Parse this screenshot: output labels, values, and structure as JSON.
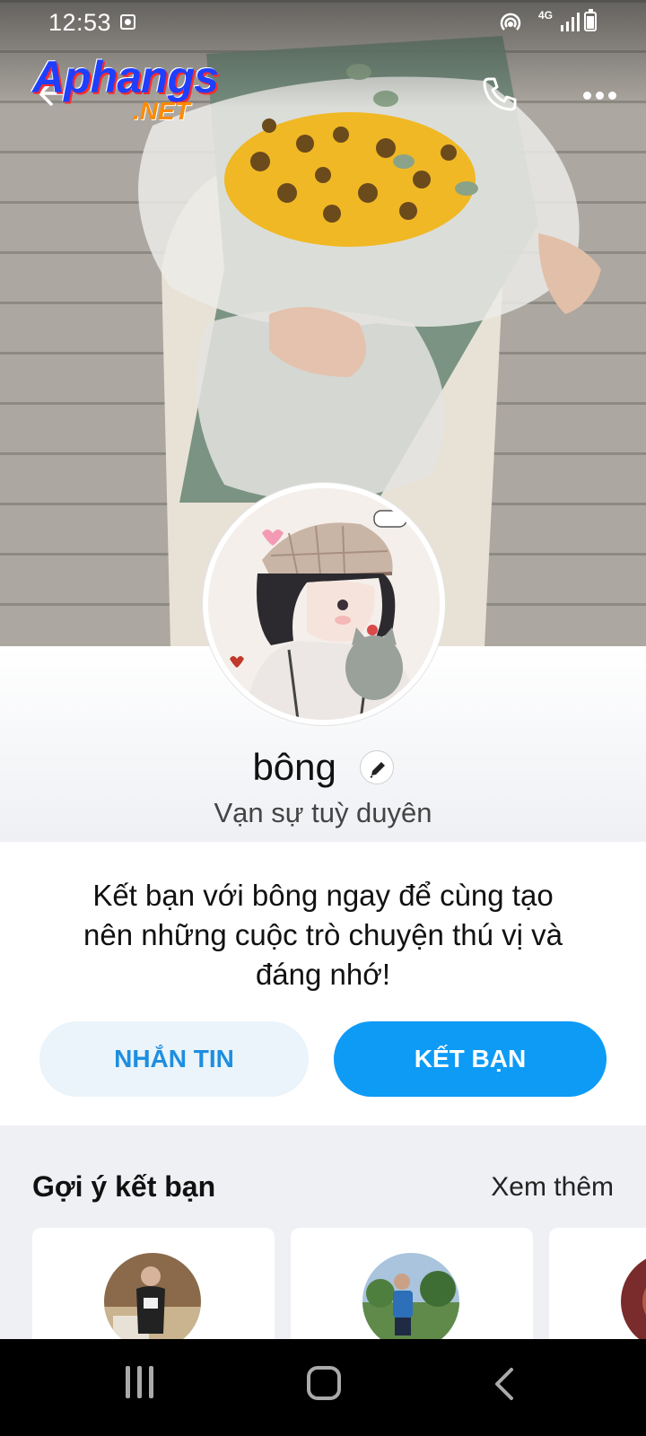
{
  "status_bar": {
    "time": "12:53",
    "network": "4G"
  },
  "watermark": {
    "main": "Aphangs",
    "sub": ".NET"
  },
  "top_nav": {
    "back_icon": "arrow-left-icon",
    "call_icon": "phone-icon",
    "more_icon": "more-horizontal-icon"
  },
  "profile": {
    "name": "bông",
    "bio": "Vạn sự tuỳ duyên",
    "edit_icon": "pencil-icon"
  },
  "invite": {
    "text": "Kết bạn với bông ngay để cùng tạo nên những cuộc trò chuyện thú vị và đáng nhớ!",
    "message_button": "NHẮN TIN",
    "add_friend_button": "KẾT BẠN"
  },
  "suggestions": {
    "title": "Gợi ý kết bạn",
    "see_more": "Xem thêm"
  },
  "colors": {
    "accent": "#0d9bf6",
    "secondary_button_bg": "#eaf4fa",
    "secondary_button_text": "#1e8ee0",
    "section_bg": "#eef0f4"
  }
}
